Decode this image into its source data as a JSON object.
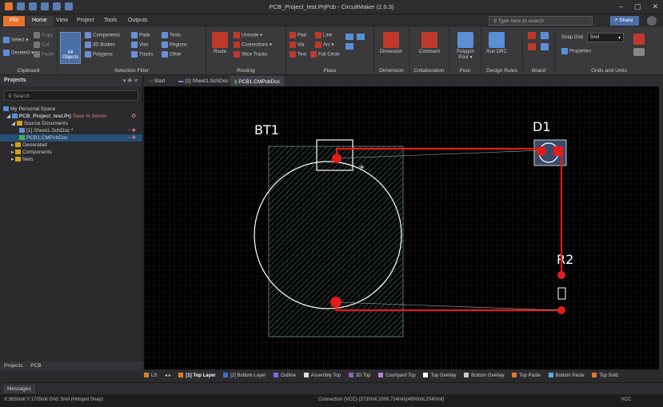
{
  "window": {
    "title": "PCB_Project_test.PrjPcb - CircuitMaker (2.0.3)",
    "controls": [
      "–",
      "▢",
      "✕"
    ]
  },
  "menu": {
    "tabs": [
      "File",
      "Home",
      "View",
      "Project",
      "Tools",
      "Outputs"
    ],
    "search_placeholder": "Type here to search",
    "share_label": "Share"
  },
  "ribbon": {
    "clipboard": {
      "title": "Clipboard",
      "items": [
        "Select",
        "Deselect",
        "Copy",
        "Cut",
        "Paste"
      ]
    },
    "selection_filter": {
      "title": "Selection Filter",
      "all_label": "All Objects",
      "items": [
        "Components",
        "Pads",
        "Texts",
        "3D Bodies",
        "Vias",
        "Regions",
        "Polygons",
        "Tracks",
        "Other"
      ]
    },
    "routing": {
      "title": "Routing",
      "route_label": "Route",
      "items": [
        "Unroute",
        "Connections",
        "Slice Tracks"
      ]
    },
    "place": {
      "title": "Place",
      "items": [
        "Pad",
        "Line",
        "Via",
        "Arc",
        "Text",
        "Full Circle"
      ]
    },
    "dimension": {
      "title": "Dimension",
      "label": "Dimension"
    },
    "collaboration": {
      "title": "Collaboration",
      "label": "Comment"
    },
    "pour": {
      "title": "Pour",
      "label": "Polygon Pour"
    },
    "design_rules": {
      "title": "Design Rules",
      "label": "Run DRC"
    },
    "board": {
      "title": "Board"
    },
    "grids": {
      "title": "Grids and Units",
      "snap_label": "Snap Grid",
      "snap_value": "5mil",
      "properties_label": "Properties"
    }
  },
  "projects_panel": {
    "title": "Projects",
    "search_placeholder": "Search",
    "tree": [
      {
        "label": "My Personal Space",
        "level": 0
      },
      {
        "label": "PCB_Project_test.Prj",
        "suffix": "Save to Server",
        "level": 1
      },
      {
        "label": "Source Documents",
        "level": 2
      },
      {
        "label": "[1] Sheet1.SchDoc *",
        "level": 3
      },
      {
        "label": "PCB1.CMPcbDoc",
        "level": 3,
        "selected": true
      },
      {
        "label": "Generated",
        "level": 2
      },
      {
        "label": "Components",
        "level": 2
      },
      {
        "label": "Nets",
        "level": 2
      }
    ],
    "footer_tabs": [
      "Projects",
      "PCB"
    ]
  },
  "doc_tabs": [
    "Start",
    "[1] Sheet1.SchDoc *",
    "PCB1.CMPcbDoc"
  ],
  "pcb": {
    "designators": [
      "BT1",
      "D1",
      "R2"
    ]
  },
  "layers": [
    {
      "name": "LS",
      "color": "#d4802a"
    },
    {
      "name": "[1] Top Layer",
      "color": "#d4802a",
      "active": true
    },
    {
      "name": "[2] Bottom Layer",
      "color": "#3b6fd6"
    },
    {
      "name": "Outline",
      "color": "#7b68ee"
    },
    {
      "name": "Assembly Top",
      "color": "#ddd"
    },
    {
      "name": "3D Top",
      "color": "#9b59b6"
    },
    {
      "name": "Courtyard Top",
      "color": "#c678dd"
    },
    {
      "name": "Top Overlay",
      "color": "#ffffff"
    },
    {
      "name": "Bottom Overlay",
      "color": "#cccccc"
    },
    {
      "name": "Top Paste",
      "color": "#e8742e"
    },
    {
      "name": "Bottom Paste",
      "color": "#5dade2"
    },
    {
      "name": "Top Sold",
      "color": "#e8742e"
    }
  ],
  "messages_tab": "Messages",
  "status": {
    "left": "X:3650mil Y:1705mil   Grid: 5mil   (Hotspot Snap)",
    "center": "Connection (VCC) (3730mil,2009.724mil)(4990mil,2040mil)",
    "right": "VCC"
  },
  "colors": {
    "accent": "#e8742e",
    "track": "#e21b1b",
    "silk": "#ffffff",
    "grid": "#333333"
  }
}
